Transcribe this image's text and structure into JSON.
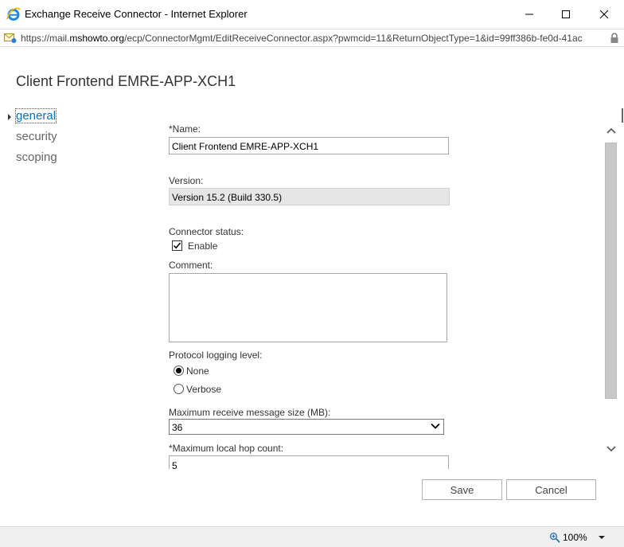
{
  "window": {
    "title": "Exchange Receive Connector - Internet Explorer"
  },
  "address_bar": {
    "url_prefix": "https://mail.",
    "url_domain": "mshowto.org",
    "url_suffix": "/ecp/ConnectorMgmt/EditReceiveConnector.aspx?pwmcid=11&ReturnObjectType=1&id=99ff386b-fe0d-41ac"
  },
  "page": {
    "title": "Client Frontend EMRE-APP-XCH1"
  },
  "nav": {
    "items": [
      {
        "label": "general",
        "active": true
      },
      {
        "label": "security",
        "active": false
      },
      {
        "label": "scoping",
        "active": false
      }
    ]
  },
  "form": {
    "name_label": "*Name:",
    "name_value": "Client Frontend EMRE-APP-XCH1",
    "version_label": "Version:",
    "version_value": "Version 15.2 (Build 330.5)",
    "status_label": "Connector status:",
    "enable_label": "Enable",
    "enable_checked": true,
    "comment_label": "Comment:",
    "comment_value": "",
    "logging_label": "Protocol logging level:",
    "logging_options": [
      {
        "label": "None",
        "selected": true
      },
      {
        "label": "Verbose",
        "selected": false
      }
    ],
    "max_size_label": "Maximum receive message size (MB):",
    "max_size_value": "36",
    "hop_label": "*Maximum local hop count:",
    "hop_value": "5"
  },
  "buttons": {
    "save": "Save",
    "cancel": "Cancel"
  },
  "status_bar": {
    "zoom": "100%"
  },
  "icons": {
    "browser": "internet-explorer-icon",
    "address": "mail-icon",
    "lock": "lock-icon",
    "zoom": "zoom-icon"
  }
}
